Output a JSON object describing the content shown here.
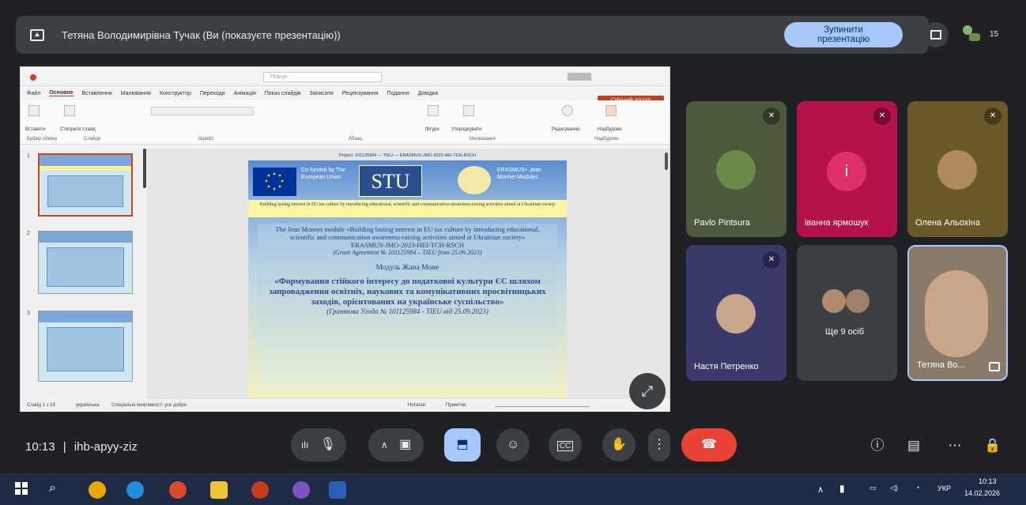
{
  "top_bar": {
    "title": "Тетяна Володимирівна Тучак (Ви (показуєте презентацію))",
    "stop_line1": "Зупинити",
    "stop_line2": "презентацію",
    "participants_count": "15"
  },
  "ppt": {
    "search_placeholder": "Пошук",
    "menu": [
      "Файл",
      "Основне",
      "Вставлення",
      "Малювання",
      "Конструктор",
      "Переходи",
      "Анімація",
      "Показ слайдів",
      "Записати",
      "Рецензування",
      "Подання",
      "Довідка"
    ],
    "share": "Спільний доступ",
    "ribbon_groups": [
      "Буфер обміну",
      "Слайди",
      "Шрифт",
      "Абзац",
      "Малювання",
      "Надбудови"
    ],
    "ribbon_labels": [
      "Вставити",
      "Створити слайд",
      "Фігури",
      "Упорядкувати",
      "Редагування",
      "Надбудови"
    ],
    "thumb_numbers": [
      "1",
      "2",
      "3"
    ],
    "slide": {
      "topline": "Project: 101125984 — TIEU — ERASMUS-JMO-2023-HEI-TCH-RSCH",
      "eu_text": "Co-funded by The European Union",
      "stu_logo": "STU",
      "jm_text": "ERASMUS+ Jean Monnet Modules",
      "banner": "Building lasting interest in EU tax culture by introducing educational, scientific and communication awareness-raising activities aimed at Ukrainian society",
      "en_body": "The Jean Monnet module «Building lasting interest in EU tax culture by introducing educational, scientific and communication awareness-raising activities aimed at Ukrainian society» ERASMUS-JMO-2023-HEI-TCH-RSCH",
      "en_grant": "(Grant Agreement № 101125984 – TIEU from 25.09.2023)",
      "uk_title": "Модуль Жана Моне",
      "uk_body": "«Формування стійкого інтересу до податкової культури ЄС шляхом запровадження освітніх, наукових та комунікативних просвітницьких заходів, орієнтованих на українське суспільство»",
      "uk_grant": "(Грантова Угода № 101125984 - TIEU від 25.09.2023)"
    },
    "status_left": "Слайд 1 з 18",
    "status_lang": "українська",
    "status_access": "Спеціальні можливості: усе добре",
    "status_notes": "Нотатки",
    "status_comments": "Примітки"
  },
  "tiles": [
    {
      "name": "Pavlo Pintsura",
      "bg": "#4a5a3a"
    },
    {
      "name": "іванна ярмошук",
      "bg": "#b3124a",
      "letter": "i"
    },
    {
      "name": "Олена Альохіна",
      "bg": "#6a5a2a"
    },
    {
      "name": "Настя Петренко",
      "bg": "#3a3a6a"
    },
    {
      "name": "Ще 9 осіб",
      "bg": "#3c4043"
    },
    {
      "name": "Тетяна Во...",
      "bg": "#8a7a6a"
    }
  ],
  "bottom": {
    "time": "10:13",
    "separator": "|",
    "meeting_code": "ihb-apyy-ziz"
  },
  "taskbar": {
    "lang": "УКР",
    "time": "10:13",
    "date": "14.02.2026"
  },
  "colors": {
    "accent": "#a8c7fa",
    "end_call": "#ea4335",
    "surface": "#3c4043",
    "background": "#202124"
  }
}
